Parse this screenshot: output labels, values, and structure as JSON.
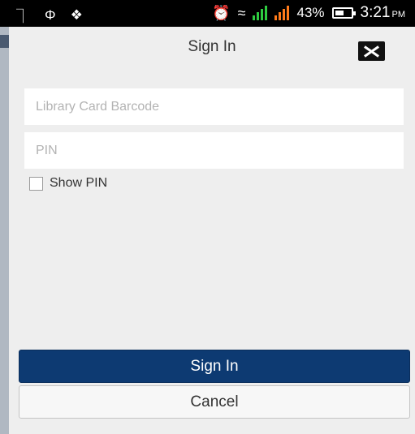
{
  "status_bar": {
    "left_icons": [
      "notification-icon",
      "usb-icon",
      "twitter-icon"
    ],
    "battery_percent": "43%",
    "time": "3:21",
    "ampm": "PM"
  },
  "dialog": {
    "title": "Sign In",
    "barcode_placeholder": "Library Card Barcode",
    "pin_placeholder": "PIN",
    "show_pin_label": "Show PIN",
    "signin_button": "Sign In",
    "cancel_button": "Cancel"
  },
  "colors": {
    "primary_button": "#0d3a72",
    "dialog_bg": "#eeeeee",
    "signal_green": "#2ecc40",
    "signal_orange": "#ff7a1a"
  }
}
